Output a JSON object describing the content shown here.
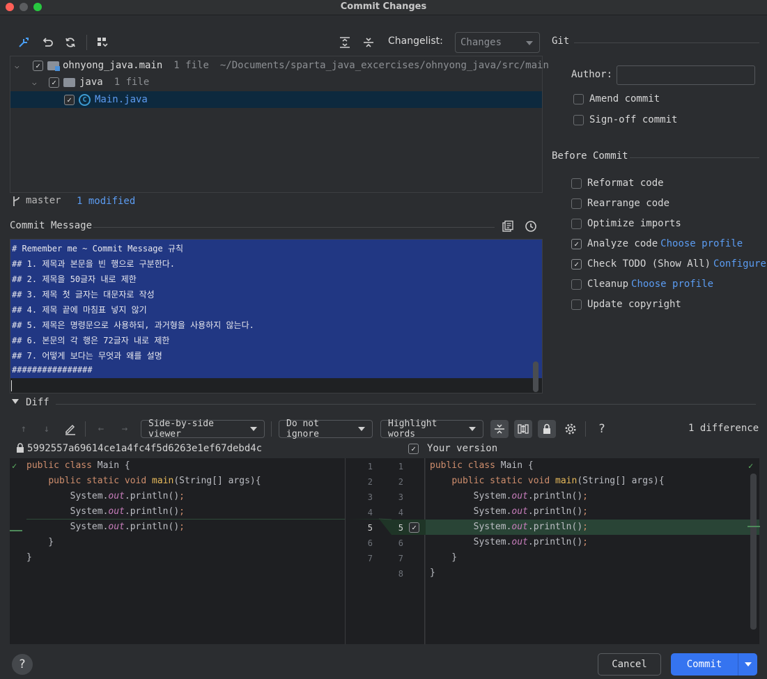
{
  "window": {
    "title": "Commit Changes"
  },
  "toolbar": {
    "changelist_label": "Changelist:",
    "changelist_value": "Changes"
  },
  "tree": {
    "root": {
      "name": "ohnyong_java.main",
      "count": "1 file",
      "path": "~/Documents/sparta_java_excercises/ohnyong_java/src/main"
    },
    "folder": {
      "name": "java",
      "count": "1 file"
    },
    "file": {
      "name": "Main.java"
    }
  },
  "branch": {
    "name": "master",
    "modified": "1 modified"
  },
  "commit_message": {
    "label": "Commit Message",
    "lines": [
      "# Remember me ~ Commit Message 규칙",
      "## 1. 제목과 본문을 빈 행으로 구분한다.",
      "## 2. 제목을 50글자 내로 제한",
      "## 3. 제목 첫 글자는 대문자로 작성",
      "## 4. 제목 끝에 마침표 넣지 않기",
      "## 5. 제목은 명령문으로 사용하되, 과거형을 사용하지 않는다.",
      "## 6. 본문의 각 행은 72글자 내로 제한",
      "## 7. 어떻게 보다는 무엇과 왜를 설명",
      "################"
    ]
  },
  "git": {
    "title": "Git",
    "author_label": "Author:",
    "author_value": "",
    "amend": "Amend commit",
    "signoff": "Sign-off commit"
  },
  "before_commit": {
    "title": "Before Commit",
    "reformat": "Reformat code",
    "rearrange": "Rearrange code",
    "optimize": "Optimize imports",
    "analyze": "Analyze code",
    "analyze_link": "Choose profile",
    "todo": "Check TODO (Show All)",
    "todo_link": "Configure",
    "cleanup": "Cleanup",
    "cleanup_link": "Choose profile",
    "copyright": "Update copyright"
  },
  "diff": {
    "title": "Diff",
    "viewer": "Side-by-side viewer",
    "ignore": "Do not ignore",
    "highlight": "Highlight words",
    "help": "?",
    "count": "1 difference",
    "left_hash": "5992557a69614ce1a4fc4f5d6263e1ef67debd4c",
    "right_label": "Your version",
    "left_numbers": [
      "1",
      "2",
      "3",
      "4",
      "5",
      "6",
      "7"
    ],
    "right_numbers": [
      "1",
      "2",
      "3",
      "4",
      "5",
      "6",
      "7",
      "8"
    ]
  },
  "buttons": {
    "help": "?",
    "cancel": "Cancel",
    "commit": "Commit"
  },
  "colors": {
    "selection": "#213783",
    "accent": "#3574f0",
    "added": "#294436"
  }
}
